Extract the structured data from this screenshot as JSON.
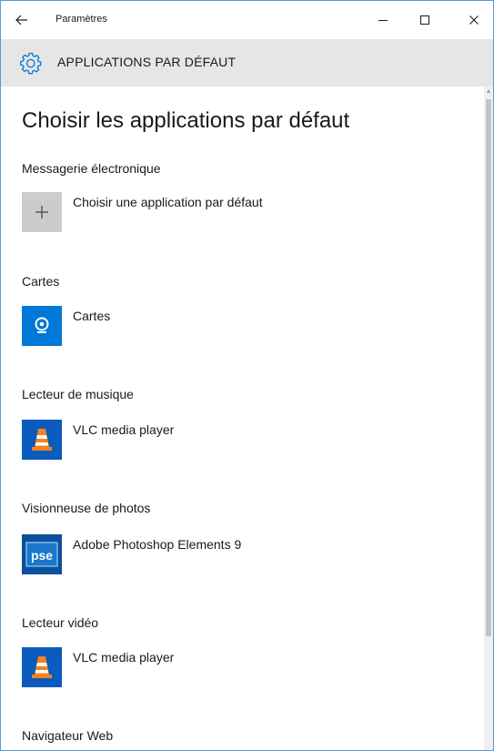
{
  "window": {
    "title": "Paramètres"
  },
  "header": {
    "title": "APPLICATIONS PAR DÉFAUT",
    "icon": "gear-icon"
  },
  "page": {
    "heading": "Choisir les applications par défaut"
  },
  "sections": [
    {
      "label": "Messagerie électronique",
      "app": "Choisir une application par défaut",
      "icon": "plus-icon"
    },
    {
      "label": "Cartes",
      "app": "Cartes",
      "icon": "maps-icon"
    },
    {
      "label": "Lecteur de musique",
      "app": "VLC media player",
      "icon": "vlc-icon"
    },
    {
      "label": "Visionneuse de photos",
      "app": "Adobe Photoshop Elements 9",
      "icon": "pse-icon",
      "icon_text": "pse"
    },
    {
      "label": "Lecteur vidéo",
      "app": "VLC media player",
      "icon": "vlc-icon"
    },
    {
      "label": "Navigateur Web"
    }
  ],
  "colors": {
    "accent": "#0078d7",
    "header_bg": "#e6e6e6",
    "plus_tile": "#cccccc"
  }
}
